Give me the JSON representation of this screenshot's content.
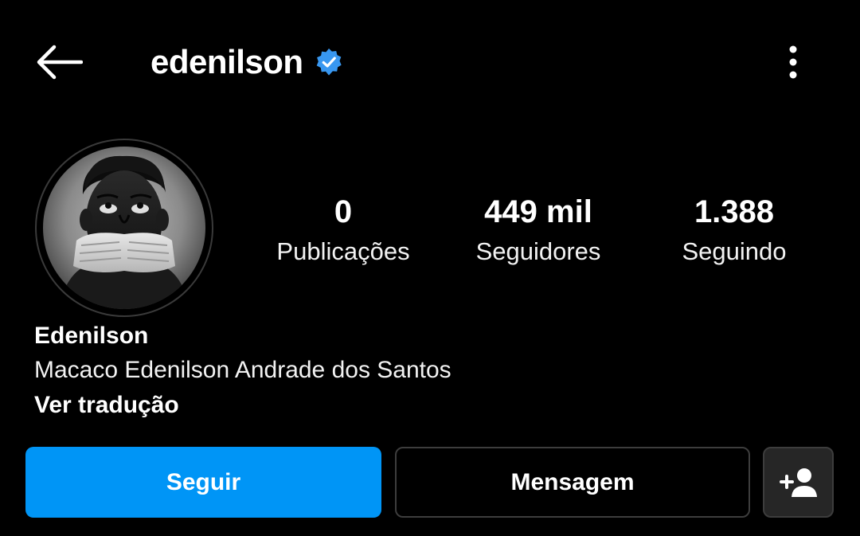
{
  "header": {
    "username": "edenilson",
    "verified": true,
    "back_icon": "arrow-left-icon",
    "more_icon": "more-vertical-icon"
  },
  "profile": {
    "avatar_description": "avatar-photo",
    "stats": [
      {
        "count": "0",
        "label": "Publicações"
      },
      {
        "count": "449 mil",
        "label": "Seguidores"
      },
      {
        "count": "1.388",
        "label": "Seguindo"
      }
    ],
    "bio": {
      "name": "Edenilson",
      "text": "Macaco Edenilson Andrade dos Santos",
      "translate_link": "Ver tradução"
    }
  },
  "actions": {
    "follow_label": "Seguir",
    "message_label": "Mensagem",
    "suggest_icon": "add-person-icon"
  },
  "colors": {
    "background": "#000000",
    "accent": "#0095f6",
    "verified_badge": "#3897f0",
    "secondary_button": "#262626",
    "border": "#3d3d3d"
  }
}
